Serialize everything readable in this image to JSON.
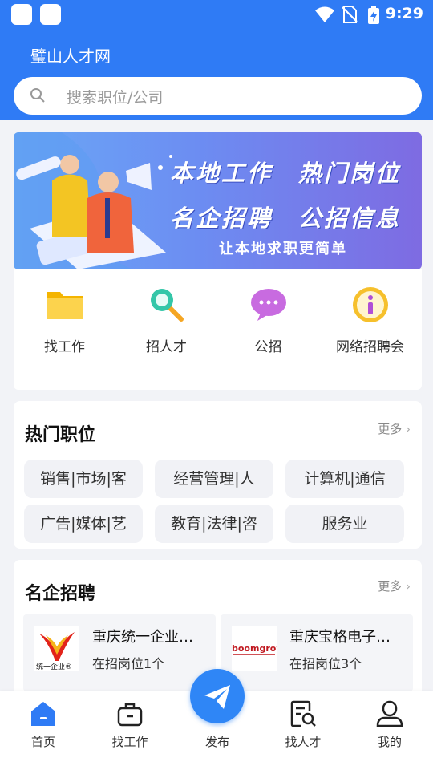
{
  "status": {
    "time": "9:29"
  },
  "app": {
    "title": "璧山人才网"
  },
  "search": {
    "placeholder": "搜索职位/公司"
  },
  "banner": {
    "line1_left": "本地工作",
    "line1_right": "热门岗位",
    "line2_left": "名企招聘",
    "line2_right": "公招信息",
    "tagline": "让本地求职更简单"
  },
  "quick": [
    {
      "label": "找工作",
      "icon": "folder-icon"
    },
    {
      "label": "招人才",
      "icon": "magnifier-icon"
    },
    {
      "label": "公招",
      "icon": "chat-bubble-icon"
    },
    {
      "label": "网络招聘会",
      "icon": "info-icon"
    }
  ],
  "hot_jobs": {
    "title": "热门职位",
    "more": "更多",
    "tags": [
      "销售|市场|客",
      "经营管理|人",
      "计算机|通信",
      "广告|媒体|艺",
      "教育|法律|咨",
      "服务业"
    ]
  },
  "companies": {
    "title": "名企招聘",
    "more": "更多",
    "items": [
      {
        "name": "重庆统一企业…",
        "positions": "在招岗位1个",
        "logo_text": "统一企业®"
      },
      {
        "name": "重庆宝格电子…",
        "positions": "在招岗位3个",
        "logo_text": "boomgrow"
      }
    ]
  },
  "fab": {
    "label": "发布"
  },
  "tabs": [
    {
      "label": "首页",
      "icon": "home-icon"
    },
    {
      "label": "找工作",
      "icon": "briefcase-icon"
    },
    {
      "label": "找人才",
      "icon": "resume-search-icon"
    },
    {
      "label": "我的",
      "icon": "profile-icon"
    }
  ],
  "colors": {
    "primary": "#2f7bf5",
    "accent_fab": "#2f86f6"
  }
}
